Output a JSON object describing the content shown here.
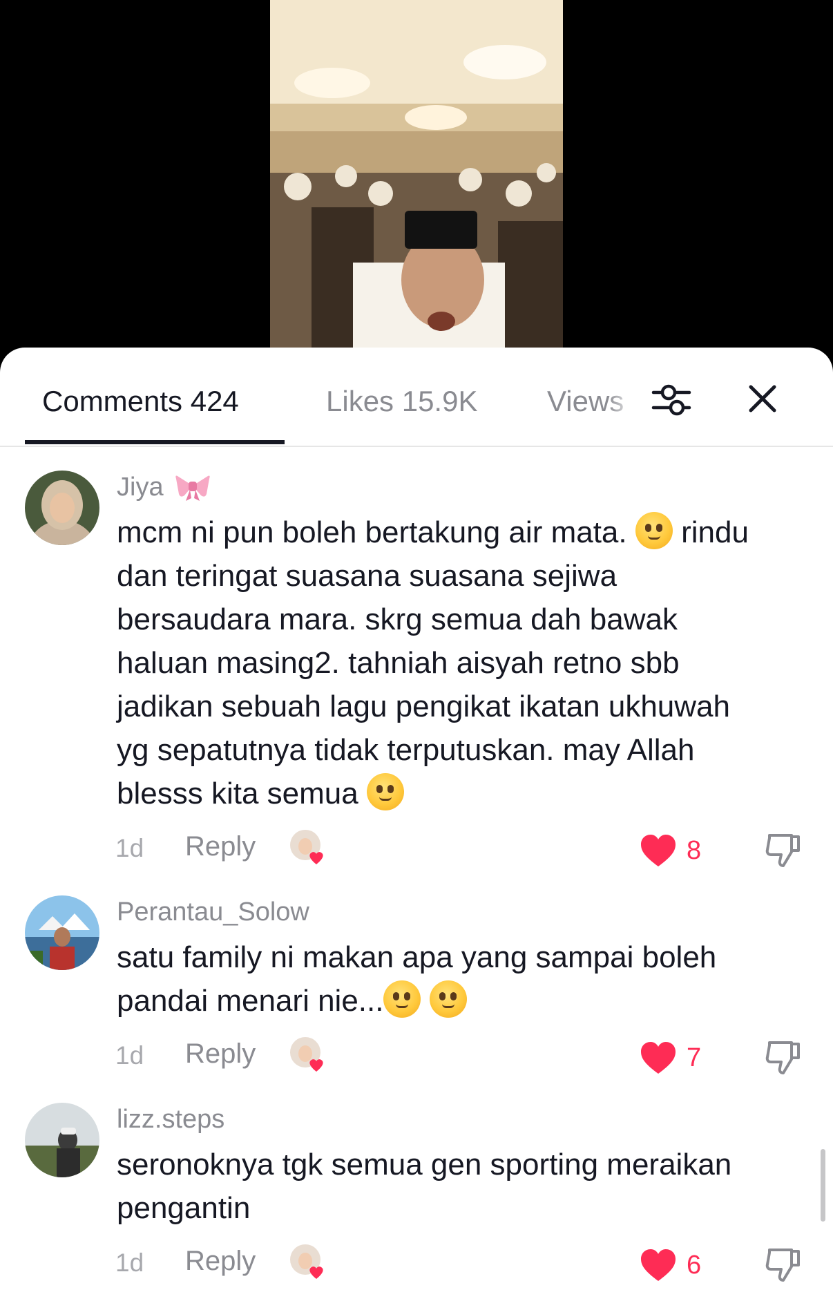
{
  "tabs": {
    "comments": "Comments 424",
    "likes": "Likes 15.9K",
    "views": "Views"
  },
  "icons": {
    "filter": "sliders-icon",
    "close": "close-icon",
    "like": "heart-icon",
    "dislike": "thumbs-down-icon"
  },
  "colors": {
    "like": "#fe2c55",
    "text": "#161823",
    "muted": "#8a8b91"
  },
  "comments": [
    {
      "username": "Jiya",
      "emoji_after_name": "ribbon-bow",
      "lines": [
        "mcm ni pun boleh bertakung air mata.",
        "rindu",
        "dan teringat suasana suasana sejiwa",
        "bersaudara mara. skrg semua dah bawak",
        "haluan masing2. tahniah aisyah retno sbb",
        "jadikan sebuah lagu pengikat ikatan ukhuwah",
        "yg sepatutnya tidak terputuskan. may Allah",
        "blesss kita semua"
      ],
      "time": "1d",
      "reply": "Reply",
      "likes": "8"
    },
    {
      "username": "Perantau_Solow",
      "lines": [
        "satu family ni makan apa yang sampai boleh",
        "pandai menari nie..."
      ],
      "time": "1d",
      "reply": "Reply",
      "likes": "7"
    },
    {
      "username": "lizz.steps",
      "lines": [
        "seronoknya tgk semua gen sporting meraikan",
        "pengantin"
      ],
      "time": "1d",
      "reply": "Reply",
      "likes": "6"
    }
  ]
}
